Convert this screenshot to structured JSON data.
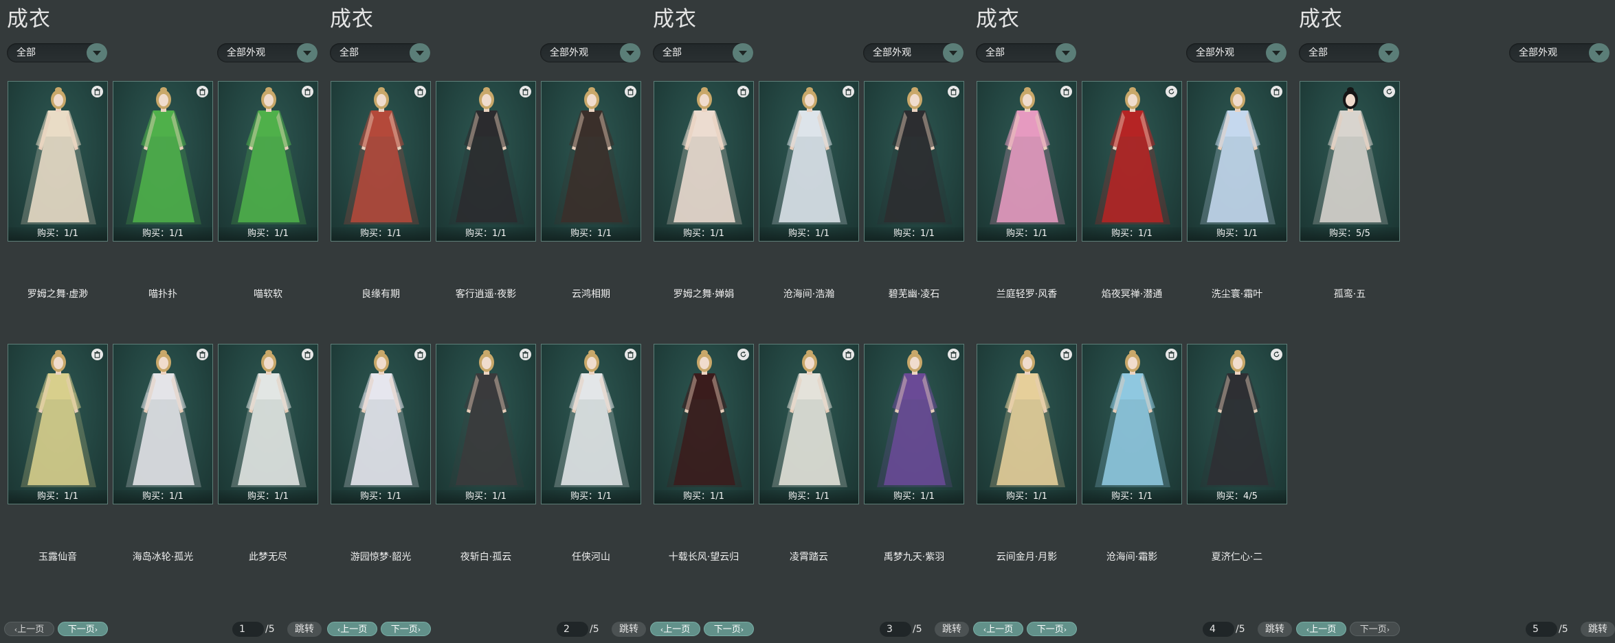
{
  "colors": {
    "background": "#343a3b",
    "card_bg": "#234541",
    "accent": "#62918a"
  },
  "panels": [
    {
      "title": "成衣",
      "filter": "全部",
      "appearance_filter": "全部外观",
      "page": "1",
      "total": "/5",
      "jump": "跳转",
      "prev": "上一页",
      "next": "下一页",
      "prev_active": false,
      "next_active": true,
      "items": [
        {
          "name": "罗姆之舞·虚渺",
          "buy": "购买：1/1",
          "color": "#e9dcc6",
          "icon": "trash-icon"
        },
        {
          "name": "喵扑扑",
          "buy": "购买：1/1",
          "color": "#4fb04a",
          "icon": "trash-icon"
        },
        {
          "name": "喵软软",
          "buy": "购买：1/1",
          "color": "#4fb04a",
          "icon": "trash-icon"
        },
        {
          "name": "玉露仙音",
          "buy": "购买：1/1",
          "color": "#d8cf8c",
          "icon": "trash-icon"
        },
        {
          "name": "海岛冰轮·孤光",
          "buy": "购买：1/1",
          "color": "#e4e4e8",
          "icon": "trash-icon"
        },
        {
          "name": "此梦无尽",
          "buy": "购买：1/1",
          "color": "#e2e6e4",
          "icon": "trash-icon"
        }
      ]
    },
    {
      "title": "成衣",
      "filter": "全部",
      "appearance_filter": "全部外观",
      "page": "2",
      "total": "/5",
      "jump": "跳转",
      "prev": "上一页",
      "next": "下一页",
      "prev_active": true,
      "next_active": true,
      "items": [
        {
          "name": "良缘有期",
          "buy": "购买：1/1",
          "color": "#b4493a",
          "icon": "trash-icon"
        },
        {
          "name": "客行逍遥·夜影",
          "buy": "购买：1/1",
          "color": "#2b2b2e",
          "icon": "trash-icon"
        },
        {
          "name": "云鸿相期",
          "buy": "购买：1/1",
          "color": "#3a2f2a",
          "icon": "trash-icon"
        },
        {
          "name": "游园惊梦·韶光",
          "buy": "购买：1/1",
          "color": "#e6e6ee",
          "icon": "trash-icon"
        },
        {
          "name": "夜斩白·孤云",
          "buy": "购买：1/1",
          "color": "#3a3a3c",
          "icon": "trash-icon"
        },
        {
          "name": "任侠河山",
          "buy": "购买：1/1",
          "color": "#e3e6e8",
          "icon": "trash-icon"
        }
      ]
    },
    {
      "title": "成衣",
      "filter": "全部",
      "appearance_filter": "全部外观",
      "page": "3",
      "total": "/5",
      "jump": "跳转",
      "prev": "上一页",
      "next": "下一页",
      "prev_active": true,
      "next_active": true,
      "items": [
        {
          "name": "罗姆之舞·婵娟",
          "buy": "购买：1/1",
          "color": "#ecdcd0",
          "icon": "trash-icon"
        },
        {
          "name": "沧海间·浩瀚",
          "buy": "购买：1/1",
          "color": "#dde4ea",
          "icon": "trash-icon"
        },
        {
          "name": "碧芜幽·凌石",
          "buy": "购买：1/1",
          "color": "#2c2d30",
          "icon": "trash-icon"
        },
        {
          "name": "十载长风·望云归",
          "buy": "购买：1/1",
          "color": "#3a1c1c",
          "icon": "refresh-icon"
        },
        {
          "name": "凌霄踏云",
          "buy": "购买：1/1",
          "color": "#e4e2da",
          "icon": "trash-icon"
        },
        {
          "name": "禹梦九天·紫羽",
          "buy": "购买：1/1",
          "color": "#6a4a96",
          "icon": "trash-icon"
        }
      ]
    },
    {
      "title": "成衣",
      "filter": "全部",
      "appearance_filter": "全部外观",
      "page": "4",
      "total": "/5",
      "jump": "跳转",
      "prev": "上一页",
      "next": "下一页",
      "prev_active": true,
      "next_active": true,
      "items": [
        {
          "name": "兰庭轻罗·风香",
          "buy": "购买：1/1",
          "color": "#e69ac0",
          "icon": "trash-icon"
        },
        {
          "name": "焰夜冥禅·潜通",
          "buy": "购买：1/1",
          "color": "#b52424",
          "icon": "refresh-icon"
        },
        {
          "name": "洗尘寰·霜叶",
          "buy": "购买：1/1",
          "color": "#c5d8ee",
          "icon": "trash-icon"
        },
        {
          "name": "云间金月·月影",
          "buy": "购买：1/1",
          "color": "#e6cf9a",
          "icon": "trash-icon"
        },
        {
          "name": "沧海间·霜影",
          "buy": "购买：1/1",
          "color": "#8fc8e0",
          "icon": "trash-icon"
        },
        {
          "name": "夏济仁心·二",
          "buy": "购买：4/5",
          "color": "#2e2f33",
          "icon": "refresh-icon"
        }
      ]
    },
    {
      "title": "成衣",
      "filter": "全部",
      "appearance_filter": "全部外观",
      "page": "5",
      "total": "/5",
      "jump": "跳转",
      "prev": "上一页",
      "next": "下一页",
      "prev_active": true,
      "next_active": false,
      "items": [
        {
          "name": "孤鸾·五",
          "buy": "购买：5/5",
          "color": "#d8d4ce",
          "icon": "refresh-icon",
          "hair": "#151515"
        }
      ]
    }
  ]
}
